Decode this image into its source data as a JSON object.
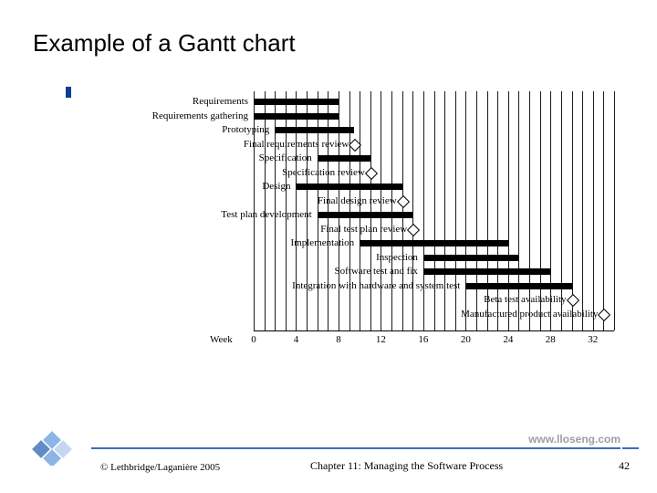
{
  "title": "Example of a Gantt chart",
  "footer": {
    "url": "www.lloseng.com",
    "credit": "© Lethbridge/Laganière 2005",
    "chapter": "Chapter 11: Managing the Software Process",
    "page": "42"
  },
  "axis": {
    "label": "Week",
    "ticks": [
      "0",
      "4",
      "8",
      "12",
      "16",
      "20",
      "24",
      "28",
      "32"
    ]
  },
  "chart_data": {
    "type": "bar",
    "title": "Example of a Gantt chart",
    "xlabel": "Week",
    "ylabel": "",
    "ylim": [
      0,
      34
    ],
    "categories": [
      "Requirements",
      "Requirements gathering",
      "Prototyping",
      "Final requirements review",
      "Specification",
      "Specification review",
      "Design",
      "Final design review",
      "Test plan development",
      "Final test plan review",
      "Implementation",
      "Inspection",
      "Software test and fix",
      "Integration with hardware and system test",
      "Beta test availability",
      "Manufactured product availability"
    ],
    "series": [
      {
        "name": "task",
        "values": [
          {
            "start": 0,
            "end": 8,
            "kind": "bar"
          },
          {
            "start": 0,
            "end": 8,
            "kind": "bar"
          },
          {
            "start": 2,
            "end": 9.5,
            "kind": "bar"
          },
          {
            "start": 9.5,
            "end": 9.5,
            "kind": "milestone"
          },
          {
            "start": 6,
            "end": 11,
            "kind": "bar"
          },
          {
            "start": 11,
            "end": 11,
            "kind": "milestone"
          },
          {
            "start": 4,
            "end": 14,
            "kind": "bar"
          },
          {
            "start": 14,
            "end": 14,
            "kind": "milestone"
          },
          {
            "start": 6,
            "end": 15,
            "kind": "bar"
          },
          {
            "start": 15,
            "end": 15,
            "kind": "milestone"
          },
          {
            "start": 10,
            "end": 24,
            "kind": "bar"
          },
          {
            "start": 16,
            "end": 25,
            "kind": "bar"
          },
          {
            "start": 16,
            "end": 28,
            "kind": "bar"
          },
          {
            "start": 20,
            "end": 30,
            "kind": "bar"
          },
          {
            "start": 30,
            "end": 30,
            "kind": "milestone"
          },
          {
            "start": 33,
            "end": 33,
            "kind": "milestone"
          }
        ]
      }
    ]
  }
}
